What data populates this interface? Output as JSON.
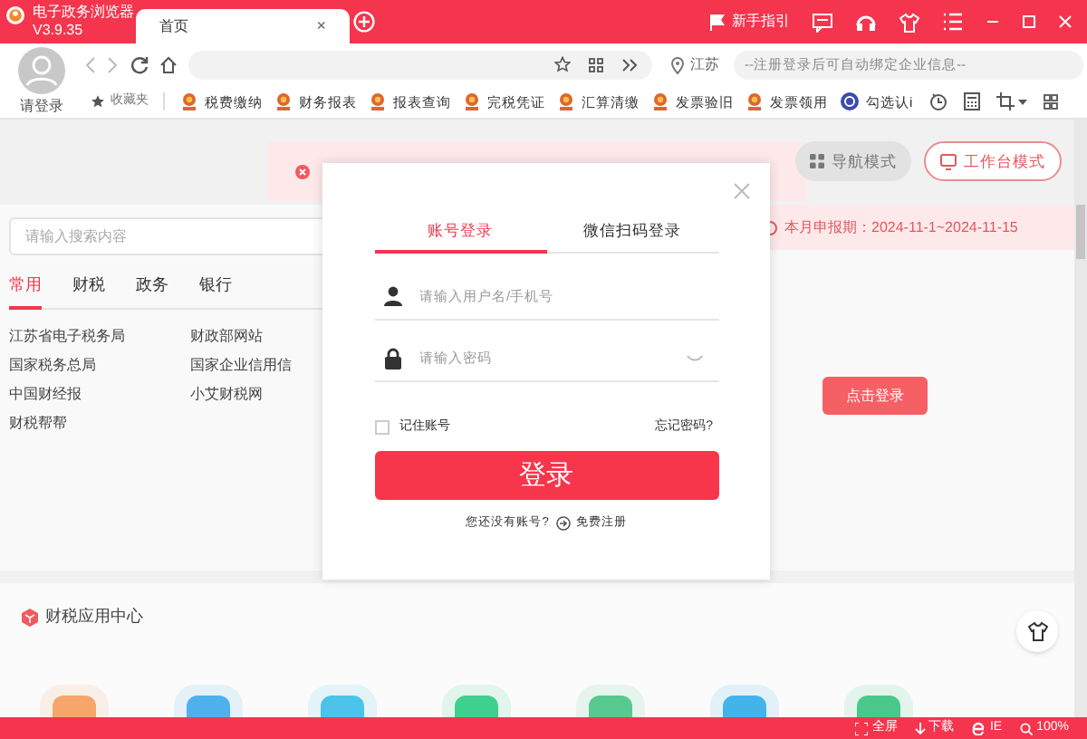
{
  "app": {
    "name": "电子政务浏览器",
    "version": "V3.9.35"
  },
  "tabs": [
    {
      "label": "首页",
      "selected": true,
      "close": "×"
    }
  ],
  "title_actions": {
    "guide": "新手指引"
  },
  "user": {
    "label": "请登录"
  },
  "location": "江苏",
  "info_field": {
    "placeholder": "--注册登录后可自动绑定企业信息--"
  },
  "favorites": "收藏夹",
  "bookmarks": [
    {
      "label": "税费缴纳",
      "kind": "emblem"
    },
    {
      "label": "财务报表",
      "kind": "emblem"
    },
    {
      "label": "报表查询",
      "kind": "emblem"
    },
    {
      "label": "完税凭证",
      "kind": "emblem"
    },
    {
      "label": "汇算清缴",
      "kind": "emblem"
    },
    {
      "label": "发票验旧",
      "kind": "emblem"
    },
    {
      "label": "发票领用",
      "kind": "emblem"
    },
    {
      "label": "勾选认i",
      "kind": "globe"
    }
  ],
  "modes": [
    {
      "label": "导航模式",
      "selected": false
    },
    {
      "label": "工作台模式",
      "selected": true
    }
  ],
  "search": {
    "placeholder": "请输入搜索内容"
  },
  "categories": [
    {
      "label": "常用",
      "selected": true
    },
    {
      "label": "财税",
      "selected": false
    },
    {
      "label": "政务",
      "selected": false
    },
    {
      "label": "银行",
      "selected": false
    }
  ],
  "links": [
    [
      "江苏省电子税务局",
      "国家税务总局",
      "中国财经报",
      "财税帮帮"
    ],
    [
      "财政部网站",
      "国家企业信用信",
      "小艾财税网"
    ]
  ],
  "period_banner": "本月申报期：2024-11-1~2024-11-15",
  "login_prompt_button": "点击登录",
  "login_dialog": {
    "tabs": [
      {
        "label": "账号登录",
        "selected": true
      },
      {
        "label": "微信扫码登录",
        "selected": false
      }
    ],
    "username": {
      "placeholder": "请输入用户名/手机号"
    },
    "password": {
      "placeholder": "请输入密码"
    },
    "remember": {
      "label": "记住账号",
      "checked": false
    },
    "forgot": "忘记密码?",
    "submit": "登录",
    "no_account": "您还没有账号?",
    "register": "免费注册"
  },
  "app_center": {
    "title": "财税应用中心",
    "tiles": [
      {
        "color": "#f6a66a"
      },
      {
        "color": "#4fb1ec"
      },
      {
        "color": "#4cc3ea"
      },
      {
        "color": "#3fcf8e"
      },
      {
        "color": "#58c98f"
      },
      {
        "color": "#43b4ea"
      },
      {
        "color": "#49c88c"
      }
    ]
  },
  "status_bar": {
    "fullscreen": "全屏",
    "download": "下载",
    "engine": "IE",
    "zoom": "100%"
  }
}
